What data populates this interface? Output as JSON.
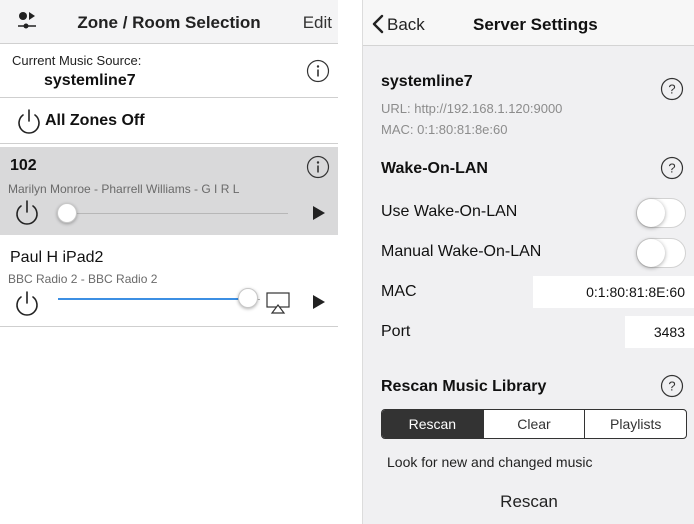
{
  "left": {
    "header": {
      "title": "Zone / Room Selection",
      "edit_label": "Edit",
      "icon": "music-source-icon"
    },
    "current_source": {
      "label": "Current Music Source:",
      "value": "systemline7",
      "icon": "info-icon"
    },
    "all_zones_off": {
      "label": "All Zones Off",
      "icon": "power-icon"
    },
    "zones": [
      {
        "name": "102",
        "track": "Marilyn Monroe - Pharrell Williams - G I R L",
        "volume": 0.02,
        "selected": true,
        "icons": [
          "info-icon",
          "power-icon",
          "play-icon"
        ]
      },
      {
        "name": "Paul H iPad2",
        "track": "BBC Radio 2 - BBC Radio 2",
        "volume": 1.0,
        "selected": false,
        "icons": [
          "power-icon",
          "airplay-icon",
          "play-icon"
        ]
      }
    ],
    "accent_color": "#3c8fe3",
    "selected_bg": "#d9d9da"
  },
  "right": {
    "header": {
      "back_label": "Back",
      "title": "Server Settings"
    },
    "server": {
      "name": "systemline7",
      "url": "URL: http://192.168.1.120:9000",
      "mac": "MAC: 0:1:80:81:8e:60"
    },
    "wol": {
      "heading": "Wake-On-LAN",
      "use_label": "Use Wake-On-LAN",
      "use_on": false,
      "manual_label": "Manual Wake-On-LAN",
      "manual_on": false,
      "mac_label": "MAC",
      "mac_value": "0:1:80:81:8E:60",
      "port_label": "Port",
      "port_value": "3483"
    },
    "rescan": {
      "heading": "Rescan Music Library",
      "segments": [
        "Rescan",
        "Clear",
        "Playlists"
      ],
      "selected_segment": "Rescan",
      "hint": "Look for new and changed music",
      "button_label": "Rescan"
    }
  }
}
